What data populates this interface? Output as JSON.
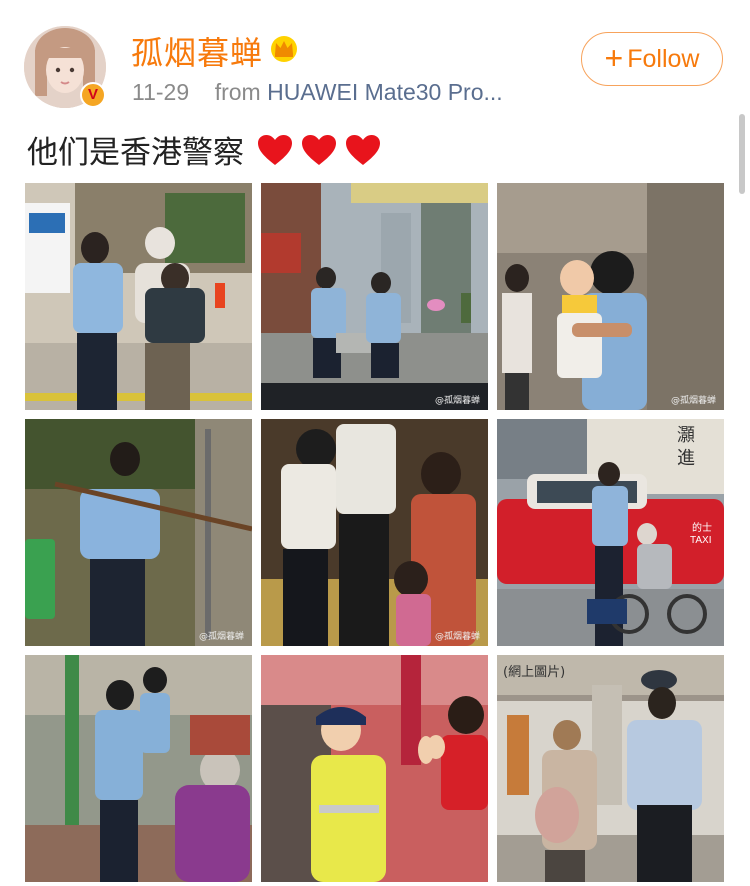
{
  "user": {
    "name": "孤烟暮蝉",
    "verified_badge": "V",
    "vip_icon": "crown-icon"
  },
  "meta": {
    "date": "11-29",
    "from_label": "from",
    "source": "HUAWEI Mate30 Pro..."
  },
  "follow_button": {
    "icon": "plus-icon",
    "label": "Follow"
  },
  "post": {
    "text": "他们是香港警察",
    "emoji": [
      "heart-icon",
      "heart-icon",
      "heart-icon"
    ]
  },
  "photos": [
    {
      "id": "photo-1",
      "subject": "police carrying elderly woman"
    },
    {
      "id": "photo-2",
      "subject": "police on street",
      "watermark": "@孤烟暮蝉"
    },
    {
      "id": "photo-3",
      "subject": "police holding child",
      "watermark": "@孤烟暮蝉"
    },
    {
      "id": "photo-4",
      "subject": "police with stick on hillside",
      "watermark": "@孤烟暮蝉"
    },
    {
      "id": "photo-5",
      "subject": "police with child",
      "watermark": "@孤烟暮蝉"
    },
    {
      "id": "photo-6",
      "subject": "police and wheelchair near taxi",
      "sign_text": "灝\n進",
      "taxi_text": "的士\nTAXI"
    },
    {
      "id": "photo-7",
      "subject": "police helping elderly"
    },
    {
      "id": "photo-8",
      "subject": "police high five child"
    },
    {
      "id": "photo-9",
      "subject": "police in subway",
      "tag": "(網上圖片)"
    }
  ],
  "colors": {
    "username": "#f77a0c",
    "follow": "#f77a0c",
    "source": "#5a6e8f",
    "heart": "#e8141c"
  }
}
